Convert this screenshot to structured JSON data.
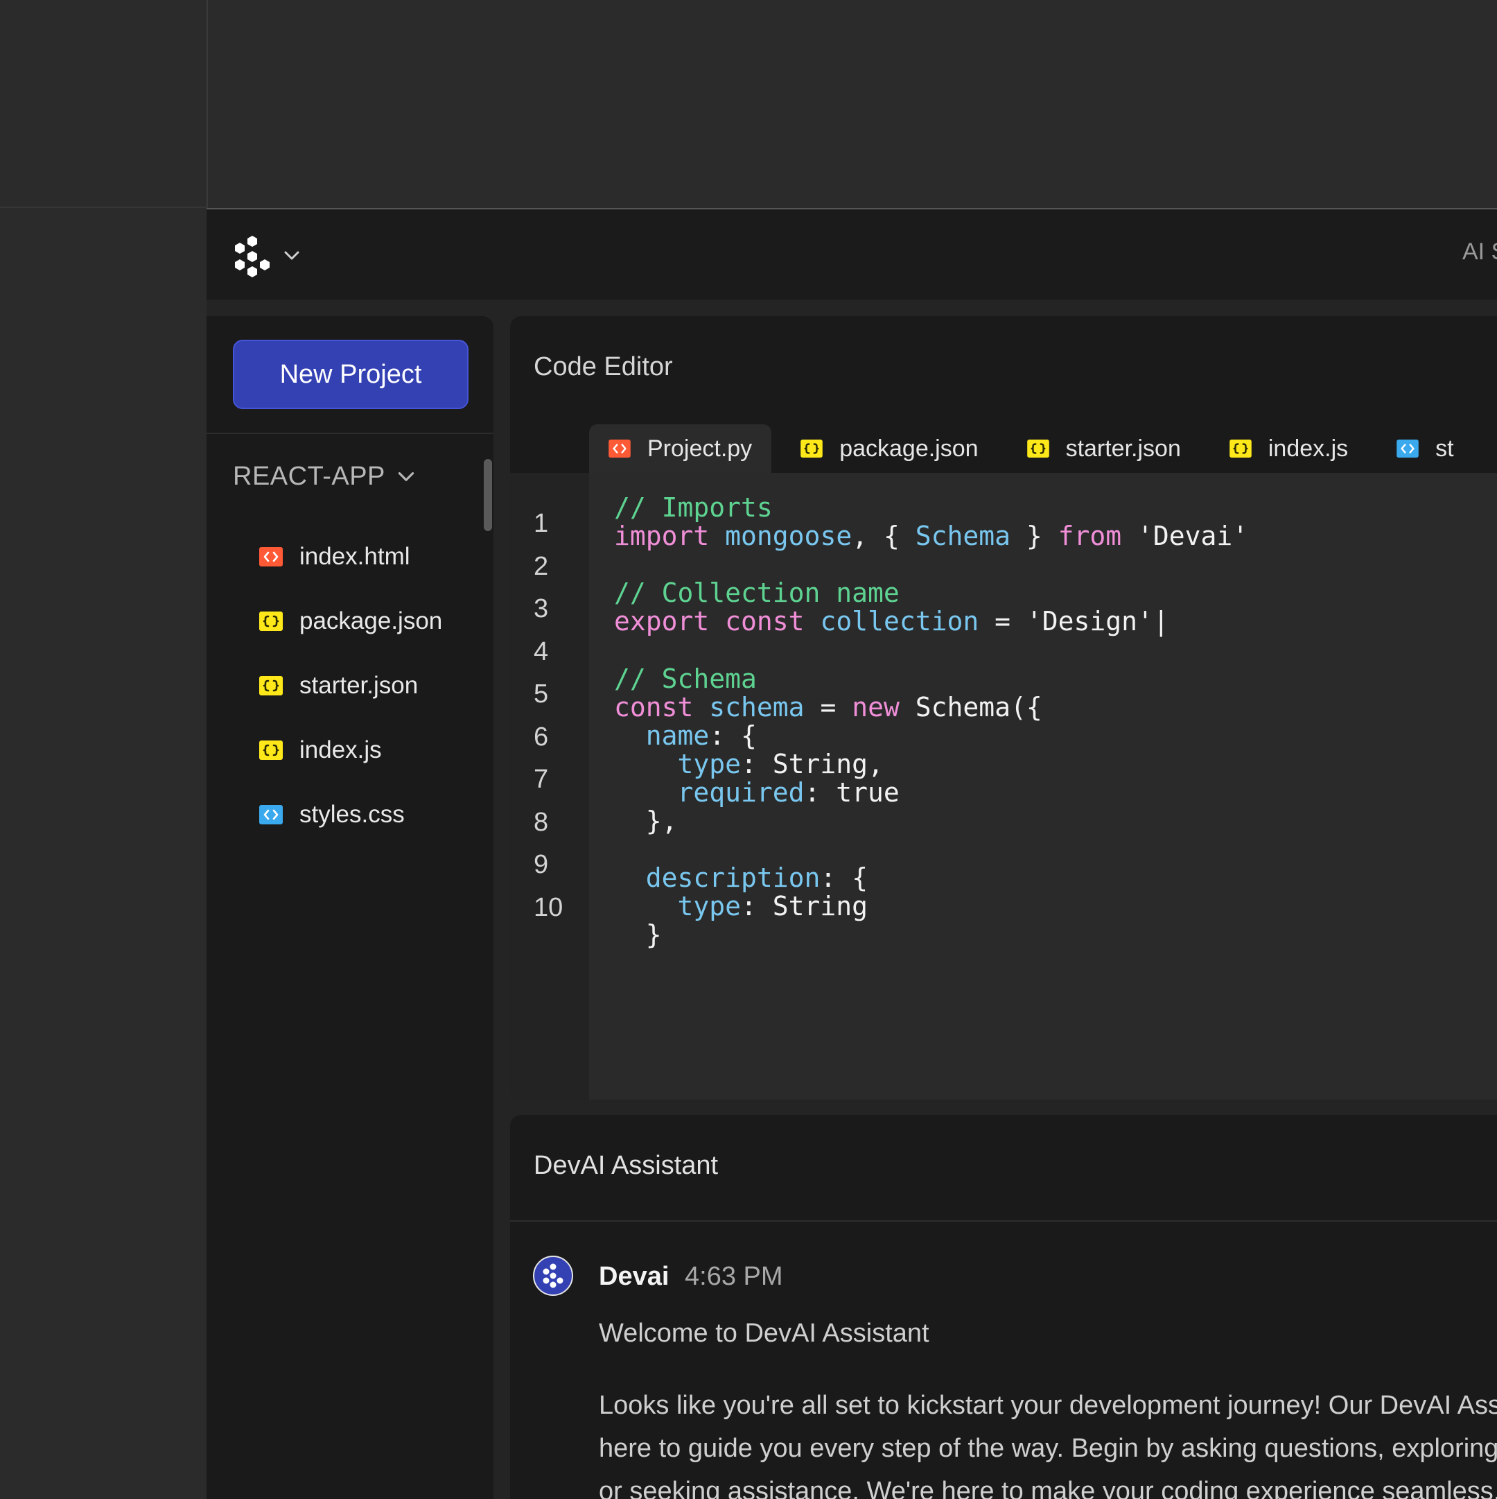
{
  "topbar": {
    "right_text": "AI S"
  },
  "sidebar": {
    "new_project_label": "New Project",
    "project_name": "REACT-APP",
    "files": [
      {
        "name": "index.html",
        "icon": "html-file-icon",
        "color": "#ff5a36"
      },
      {
        "name": "package.json",
        "icon": "json-file-icon",
        "color": "#ffe81a"
      },
      {
        "name": "starter.json",
        "icon": "json-file-icon",
        "color": "#ffe81a"
      },
      {
        "name": "index.js",
        "icon": "js-file-icon",
        "color": "#ffe81a"
      },
      {
        "name": "styles.css",
        "icon": "css-file-icon",
        "color": "#3aa9ee"
      }
    ]
  },
  "editor": {
    "title": "Code Editor",
    "tabs": [
      {
        "label": "Project.py",
        "icon": "html-file-icon",
        "color": "#ff5a36",
        "active": true
      },
      {
        "label": "package.json",
        "icon": "json-file-icon",
        "color": "#ffe81a",
        "active": false
      },
      {
        "label": "starter.json",
        "icon": "json-file-icon",
        "color": "#ffe81a",
        "active": false
      },
      {
        "label": "index.js",
        "icon": "js-file-icon",
        "color": "#ffe81a",
        "active": false
      },
      {
        "label": "st",
        "icon": "css-file-icon",
        "color": "#3aa9ee",
        "active": false
      }
    ],
    "line_numbers": [
      "1",
      "2",
      "3",
      "4",
      "5",
      "6",
      "7",
      "8",
      "9",
      "10"
    ],
    "code": {
      "l1": [
        "// Imports"
      ],
      "l2": [
        "import",
        " ",
        "mongoose",
        ", { ",
        "Schema",
        " } ",
        "from",
        " 'Devai'"
      ],
      "l3": [
        "// Collection name"
      ],
      "l4": [
        "export",
        " ",
        "const",
        " ",
        "collection",
        " = 'Design'|"
      ],
      "l5": [
        "// Schema"
      ],
      "l6": [
        "const",
        " ",
        "schema",
        " = ",
        "new",
        " Schema({"
      ],
      "l7": [
        "  ",
        "name",
        ": {"
      ],
      "l8": [
        "    ",
        "type",
        ": String,"
      ],
      "l9": [
        "    ",
        "required",
        ": true"
      ],
      "l10": [
        "  },"
      ],
      "l11": [
        "  ",
        "description",
        ": {"
      ],
      "l12": [
        "    ",
        "type",
        ": String"
      ],
      "l13": [
        "  }"
      ]
    }
  },
  "assistant": {
    "title": "DevAI Assistant",
    "message": {
      "author": "Devai",
      "time": "4:63 PM",
      "heading": "Welcome to DevAI Assistant",
      "body": "Looks like you're all set to kickstart your development journey! Our DevAI Assistant is here to guide you every step of the way. Begin by asking questions, exploring features, or seeking assistance. We're here to make your coding experience seamless."
    }
  },
  "colors": {
    "accent": "#3441b3",
    "comment": "#5ed391",
    "keyword": "#f08fd8",
    "identifier": "#79c7ef"
  }
}
